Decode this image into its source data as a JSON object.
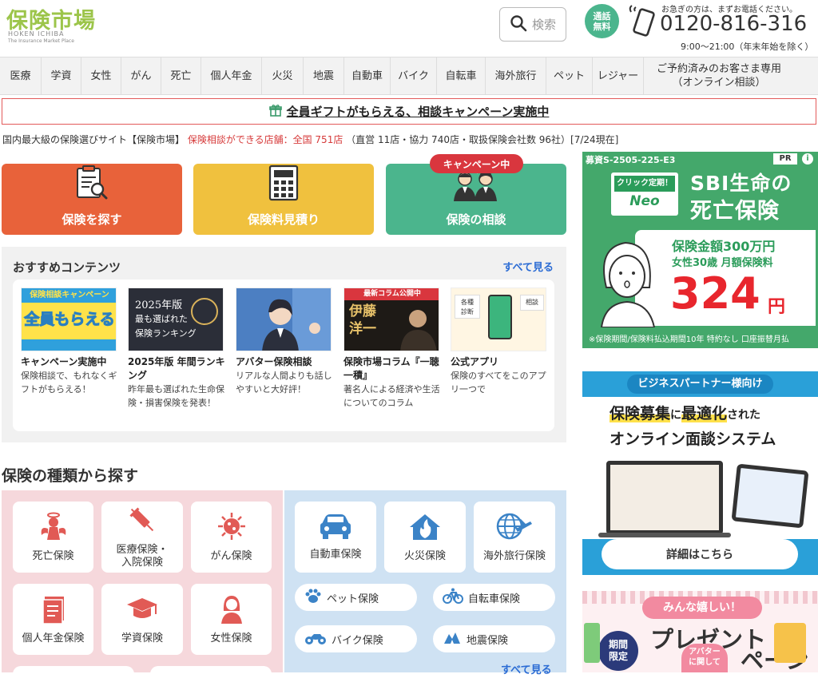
{
  "header": {
    "logo_text": "保険市場",
    "logo_en": "HOKEN ICHIBA",
    "logo_sub": "The Insurance Market Place",
    "search_label": "検索",
    "free_badge": "通話\n無料",
    "phone_note": "お急ぎの方は、まずお電話ください。",
    "phone_number": "0120-816-316",
    "phone_hours": "9:00〜21:00（年末年始を除く）"
  },
  "nav": {
    "items": [
      "医療",
      "学資",
      "女性",
      "がん",
      "死亡",
      "個人年金",
      "火災",
      "地震",
      "自動車",
      "バイク",
      "自転車",
      "海外旅行",
      "ペット",
      "レジャー",
      "ご予約済みのお客さま専用\n（オンライン相談）"
    ]
  },
  "campaign_banner": "全員ギフトがもらえる、相談キャンペーン実施中",
  "intro": {
    "lead": "国内最大級の保険選びサイト【保険市場】",
    "red": "保険相談ができる店舗：全国 751店",
    "tail": "（直営 11店・協力 740店・取扱保険会社数 96社）[7/24現在]"
  },
  "main_buttons": {
    "find": "保険を探す",
    "estimate": "保険料見積り",
    "consult": "保険の相談",
    "campaign_tag": "キャンペーン中"
  },
  "recommended": {
    "title": "おすすめコンテンツ",
    "see_all": "すべて見る",
    "items": [
      {
        "title": "キャンペーン実施中",
        "desc": "保険相談で、もれなくギフトがもらえる！",
        "thumb_top": "保険相談キャンペーン",
        "thumb_main": "全員もらえる"
      },
      {
        "title": "2025年版 年間ランキング",
        "desc": "昨年最も選ばれた生命保険・損害保険を発表！",
        "thumb_top": "2025年版",
        "thumb_main": "最も選ばれた\n保険ランキング"
      },
      {
        "title": "アバター保険相談",
        "desc": "リアルな人間よりも話しやすいと大好評！",
        "thumb_top": "",
        "thumb_main": ""
      },
      {
        "title": "保険市場コラム『一聴一積』",
        "desc": "著名人による経済や生活についてのコラム",
        "thumb_top": "最新コラム公開中",
        "thumb_main": "伊藤\n洋一"
      },
      {
        "title": "公式アプリ",
        "desc": "保険のすべてをこのアプリ一つで",
        "thumb_top": "各種\n診断",
        "thumb_main": "相談"
      }
    ]
  },
  "types": {
    "title": "保険の種類から探す",
    "life": [
      {
        "label": "死亡保険",
        "icon": "angel-icon"
      },
      {
        "label": "医療保険・\n入院保険",
        "icon": "syringe-icon"
      },
      {
        "label": "がん保険",
        "icon": "virus-icon"
      },
      {
        "label": "個人年金保険",
        "icon": "book-icon"
      },
      {
        "label": "学資保険",
        "icon": "graduation-cap-icon"
      },
      {
        "label": "女性保険",
        "icon": "woman-icon"
      }
    ],
    "general_tiles": [
      {
        "label": "自動車保険",
        "icon": "car-icon"
      },
      {
        "label": "火災保険",
        "icon": "house-fire-icon"
      },
      {
        "label": "海外旅行保険",
        "icon": "globe-plane-icon"
      }
    ],
    "general_pills": [
      {
        "label": "ペット保険",
        "icon": "paw-icon"
      },
      {
        "label": "自転車保険",
        "icon": "bicycle-icon"
      },
      {
        "label": "バイク保険",
        "icon": "motorbike-icon"
      },
      {
        "label": "地震保険",
        "icon": "earthquake-icon"
      }
    ],
    "see_all": "すべて見る"
  },
  "ads": {
    "ad1": {
      "code": "募資S-2505-225-E3",
      "pr": "PR",
      "brand": "クリック定期！",
      "brand_sub": "Neo",
      "title_line1": "SBI生命の",
      "title_line2": "死亡保険",
      "amount_line": "保険金額300万円",
      "profile_line": "女性30歳 月額保険料",
      "price": "324",
      "price_unit": "円",
      "note": "※保険期間/保険料払込期間10年 特約なし 口座振替月払"
    },
    "ad2": {
      "tag": "ビジネスパートナー様向け",
      "line1a": "保険募集",
      "line1b": "に",
      "line1c": "最適化",
      "line1d": "された",
      "line2": "オンライン面談システム",
      "button": "詳細はこちら"
    },
    "ad3": {
      "bubble": "みんな嬉しい！",
      "title": "プレゼント",
      "title2": "ペーン",
      "limited": "期間\n限定",
      "avatar": "アバター\nに関して"
    }
  },
  "colors": {
    "find": "#e8623a",
    "estimate": "#f0c13e",
    "consult": "#4bb58d",
    "accent_blue": "#2a6bd4",
    "campaign_red": "#d9363e"
  }
}
